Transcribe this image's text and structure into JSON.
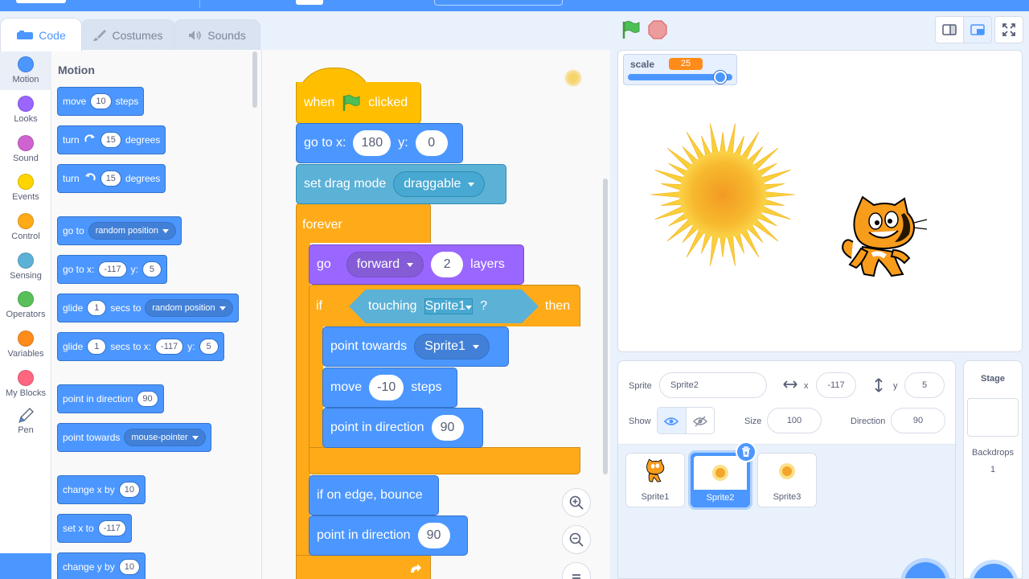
{
  "tabs": [
    {
      "label": "Code",
      "icon": "code-icon",
      "active": true
    },
    {
      "label": "Costumes",
      "icon": "brush-icon",
      "active": false
    },
    {
      "label": "Sounds",
      "icon": "speaker-icon",
      "active": false
    }
  ],
  "categories": [
    {
      "label": "Motion",
      "color": "#4c97ff"
    },
    {
      "label": "Looks",
      "color": "#9966ff"
    },
    {
      "label": "Sound",
      "color": "#cf63cf"
    },
    {
      "label": "Events",
      "color": "#ffd500"
    },
    {
      "label": "Control",
      "color": "#ffab19"
    },
    {
      "label": "Sensing",
      "color": "#5cb1d6"
    },
    {
      "label": "Operators",
      "color": "#59c059"
    },
    {
      "label": "Variables",
      "color": "#ff8c1a"
    },
    {
      "label": "My Blocks",
      "color": "#ff6680"
    },
    {
      "label": "Pen",
      "icon": "pen-icon"
    }
  ],
  "palette": {
    "title": "Motion",
    "move": {
      "label": "move",
      "steps": "10",
      "suffix": "steps"
    },
    "turn_right": {
      "label": "turn",
      "value": "15",
      "suffix": "degrees"
    },
    "turn_left": {
      "label": "turn",
      "value": "15",
      "suffix": "degrees"
    },
    "goto": {
      "label": "go to",
      "target": "random position"
    },
    "goto_xy": {
      "label": "go to x:",
      "x": "-117",
      "ylabel": "y:",
      "y": "5"
    },
    "glide": {
      "label": "glide",
      "secs": "1",
      "mid": "secs to",
      "target": "random position"
    },
    "glide_xy": {
      "label": "glide",
      "secs": "1",
      "mid": "secs to x:",
      "x": "-117",
      "ylabel": "y:",
      "y": "5"
    },
    "point_dir": {
      "label": "point in direction",
      "value": "90"
    },
    "point_towards": {
      "label": "point towards",
      "target": "mouse-pointer"
    },
    "change_x": {
      "label": "change x by",
      "value": "10"
    },
    "set_x": {
      "label": "set x to",
      "value": "-117"
    },
    "change_y": {
      "label": "change y by",
      "value": "10"
    }
  },
  "script": {
    "when_flag": {
      "pre": "when",
      "post": "clicked"
    },
    "goto_xy": {
      "label": "go to x:",
      "x": "180",
      "ylabel": "y:",
      "y": "0"
    },
    "drag_mode": {
      "label": "set drag mode",
      "value": "draggable"
    },
    "forever": {
      "label": "forever"
    },
    "go_layers": {
      "label": "go",
      "direction": "forward",
      "value": "2",
      "suffix": "layers"
    },
    "if_touching": {
      "if": "if",
      "touching": "touching",
      "target": "Sprite1",
      "q": "?",
      "then": "then"
    },
    "point_towards": {
      "label": "point towards",
      "target": "Sprite1"
    },
    "move": {
      "label": "move",
      "value": "-10",
      "suffix": "steps"
    },
    "point_dir_inner": {
      "label": "point in direction",
      "value": "90"
    },
    "bounce": {
      "label": "if on edge, bounce"
    },
    "point_dir_outer": {
      "label": "point in direction",
      "value": "90"
    }
  },
  "stage": {
    "monitor": {
      "label": "scale",
      "value": "25",
      "slider_fraction": 0.92
    }
  },
  "sprite_info": {
    "sprite_label": "Sprite",
    "sprite_name": "Sprite2",
    "x_label": "x",
    "x": "-117",
    "y_label": "y",
    "y": "5",
    "show_label": "Show",
    "size_label": "Size",
    "size": "100",
    "direction_label": "Direction",
    "direction": "90"
  },
  "sprites": [
    {
      "name": "Sprite1",
      "selected": false
    },
    {
      "name": "Sprite2",
      "selected": true
    },
    {
      "name": "Sprite3",
      "selected": false
    }
  ],
  "stage_panel": {
    "title": "Stage",
    "backdrops_label": "Backdrops",
    "backdrops_count": "1"
  },
  "colors": {
    "motion": "#4c97ff",
    "events": "#ffbf00",
    "control": "#ffab19",
    "sensing": "#5cb1d6",
    "looks": "#9966ff",
    "monitor_value": "#ff8c1a"
  }
}
